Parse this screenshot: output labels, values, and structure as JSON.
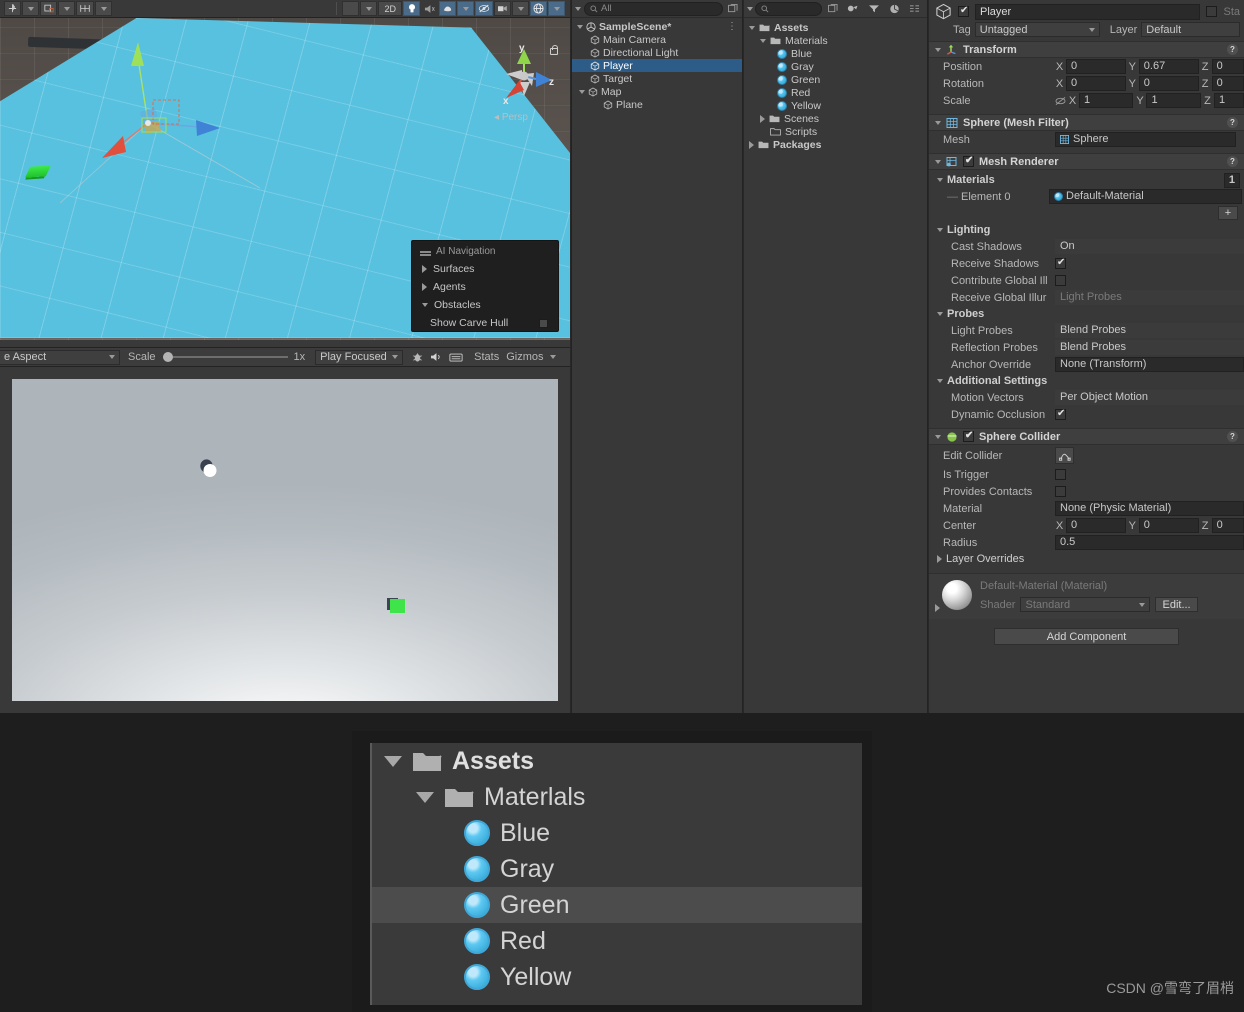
{
  "scene_view": {
    "toolbar": {
      "tool_icons": [
        "move-tool",
        "rect-tool",
        "transform-tool"
      ],
      "right_icons": [
        "shading-mode",
        "2d-toggle",
        "lighting-toggle",
        "audio-toggle",
        "fx-toggle",
        "hidden-objects-toggle",
        "camera-toggle",
        "gizmos-toggle"
      ],
      "twod_label": "2D"
    },
    "gizmo": {
      "x_label": "x",
      "y_label": "y",
      "z_label": "z",
      "projection": "Persp"
    },
    "nav_overlay": {
      "title": "AI Navigation",
      "items": [
        {
          "label": "Surfaces",
          "expanded": false
        },
        {
          "label": "Agents",
          "expanded": false
        },
        {
          "label": "Obstacles",
          "expanded": true
        }
      ],
      "sub_item": {
        "label": "Show Carve Hull",
        "checked": false
      }
    }
  },
  "game_view": {
    "toolbar": {
      "aspect": "e Aspect",
      "scale_label": "Scale",
      "scale_value": "1x",
      "play_mode": "Play Focused",
      "stats_label": "Stats",
      "gizmos_label": "Gizmos",
      "icons": [
        "mute-audio-icon",
        "bug-icon",
        "screen-icon"
      ]
    }
  },
  "hierarchy": {
    "search_placeholder": "All",
    "scene_name": "SampleScene*",
    "items": [
      {
        "label": "Main Camera",
        "depth": 1,
        "selected": false,
        "expandable": false
      },
      {
        "label": "Directional Light",
        "depth": 1,
        "selected": false,
        "expandable": false
      },
      {
        "label": "Player",
        "depth": 1,
        "selected": true,
        "expandable": false
      },
      {
        "label": "Target",
        "depth": 1,
        "selected": false,
        "expandable": false
      },
      {
        "label": "Map",
        "depth": 1,
        "selected": false,
        "expandable": true
      },
      {
        "label": "Plane",
        "depth": 2,
        "selected": false,
        "expandable": false
      }
    ]
  },
  "project": {
    "items": [
      {
        "label": "Assets",
        "depth": 0,
        "type": "folder",
        "expanded": true,
        "bold": true
      },
      {
        "label": "Materials",
        "depth": 1,
        "type": "folder",
        "expanded": true,
        "bold": false
      },
      {
        "label": "Blue",
        "depth": 2,
        "type": "material"
      },
      {
        "label": "Gray",
        "depth": 2,
        "type": "material"
      },
      {
        "label": "Green",
        "depth": 2,
        "type": "material"
      },
      {
        "label": "Red",
        "depth": 2,
        "type": "material"
      },
      {
        "label": "Yellow",
        "depth": 2,
        "type": "material"
      },
      {
        "label": "Scenes",
        "depth": 1,
        "type": "folder",
        "expanded": false,
        "bold": false
      },
      {
        "label": "Scripts",
        "depth": 1,
        "type": "folder-empty",
        "expanded": false,
        "bold": false
      },
      {
        "label": "Packages",
        "depth": 0,
        "type": "folder",
        "expanded": false,
        "bold": true
      }
    ]
  },
  "inspector": {
    "object_name": "Player",
    "enabled": true,
    "static_label": "Sta",
    "tag_label": "Tag",
    "tag_value": "Untagged",
    "layer_label": "Layer",
    "layer_value": "Default",
    "transform": {
      "title": "Transform",
      "rows": [
        {
          "label": "Position",
          "x": "0",
          "y": "0.67",
          "z": "0"
        },
        {
          "label": "Rotation",
          "x": "0",
          "y": "0",
          "z": "0"
        },
        {
          "label": "Scale",
          "x": "1",
          "y": "1",
          "z": "1"
        }
      ]
    },
    "mesh_filter": {
      "title": "Sphere (Mesh Filter)",
      "mesh_label": "Mesh",
      "mesh_value": "Sphere"
    },
    "mesh_renderer": {
      "title": "Mesh Renderer",
      "enabled": true,
      "materials_label": "Materials",
      "materials_count": "1",
      "element_label": "Element 0",
      "element_value": "Default-Material",
      "add_label": "+",
      "lighting_label": "Lighting",
      "cast_shadows_label": "Cast Shadows",
      "cast_shadows_value": "On",
      "receive_shadows_label": "Receive Shadows",
      "receive_shadows_checked": true,
      "contribute_gi_label": "Contribute Global Ill",
      "contribute_gi_checked": false,
      "receive_gi_label": "Receive Global Illur",
      "receive_gi_value": "Light Probes",
      "probes_label": "Probes",
      "light_probes_label": "Light Probes",
      "light_probes_value": "Blend Probes",
      "reflection_probes_label": "Reflection Probes",
      "reflection_probes_value": "Blend Probes",
      "anchor_override_label": "Anchor Override",
      "anchor_override_value": "None (Transform)",
      "additional_settings_label": "Additional Settings",
      "motion_vectors_label": "Motion Vectors",
      "motion_vectors_value": "Per Object Motion",
      "dynamic_occlusion_label": "Dynamic Occlusion",
      "dynamic_occlusion_checked": true
    },
    "sphere_collider": {
      "title": "Sphere Collider",
      "enabled": true,
      "edit_collider_label": "Edit Collider",
      "is_trigger_label": "Is Trigger",
      "is_trigger_checked": false,
      "provides_contacts_label": "Provides Contacts",
      "provides_contacts_checked": false,
      "material_label": "Material",
      "material_value": "None (Physic Material)",
      "center_label": "Center",
      "center_x": "0",
      "center_y": "0",
      "center_z": "0",
      "radius_label": "Radius",
      "radius_value": "0.5",
      "layer_overrides_label": "Layer Overrides"
    },
    "material_preview": {
      "title": "Default-Material (Material)",
      "shader_label": "Shader",
      "shader_value": "Standard",
      "edit_label": "Edit..."
    },
    "add_component_label": "Add Component"
  },
  "magnified_panel": {
    "rows": [
      {
        "label": "Assets",
        "depth": 0,
        "type": "folder",
        "bold": true,
        "selected": false
      },
      {
        "label": "Materlals",
        "depth": 1,
        "type": "folder",
        "bold": false,
        "selected": false
      },
      {
        "label": "Blue",
        "depth": 2,
        "type": "material",
        "bold": false,
        "selected": false
      },
      {
        "label": "Gray",
        "depth": 2,
        "type": "material",
        "bold": false,
        "selected": false
      },
      {
        "label": "Green",
        "depth": 2,
        "type": "material",
        "bold": false,
        "selected": true
      },
      {
        "label": "Red",
        "depth": 2,
        "type": "material",
        "bold": false,
        "selected": false
      },
      {
        "label": "Yellow",
        "depth": 2,
        "type": "material",
        "bold": false,
        "selected": false
      }
    ]
  },
  "watermark": "CSDN @雪弯了眉梢",
  "colors": {
    "selection_blue": "#2d5c88",
    "accent_blue": "#4a6b8a",
    "plane_cyan": "#57c1df",
    "panel_bg": "#383838"
  }
}
